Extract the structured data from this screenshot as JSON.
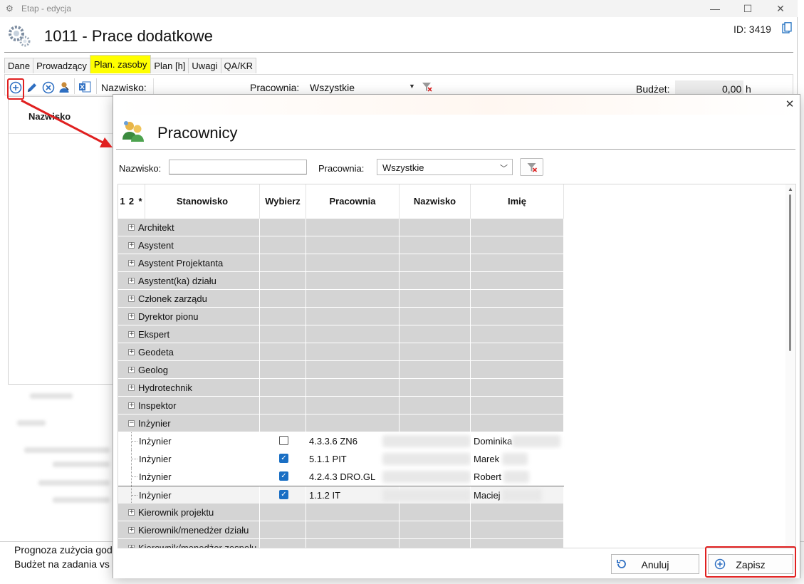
{
  "background_window": {
    "title": "Etap - edycja",
    "controls": {
      "minimize": "—",
      "maximize": "☐",
      "close": "✕"
    },
    "header_title": "1011 - Prace dodatkowe",
    "id_text": "ID: 3419",
    "tabs": [
      {
        "label": "Dane"
      },
      {
        "label": "Prowadzący"
      },
      {
        "label": "Plan. zasoby",
        "active": true
      },
      {
        "label": "Plan [h]"
      },
      {
        "label": "Uwagi"
      },
      {
        "label": "QA/KR"
      }
    ],
    "toolbar": {
      "nazwisko_label": "Nazwisko:",
      "pracownia_label": "Pracownia:",
      "pracownia_value": "Wszystkie",
      "budzet_label": "Budżet:",
      "budzet_value": "0,00",
      "budzet_unit": "h",
      "icons": [
        "add-icon",
        "edit-icon",
        "delete-icon",
        "user-icon",
        "excel-icon"
      ]
    },
    "grid": {
      "column_nazwisko": "Nazwisko"
    },
    "bottom_lines": [
      "Prognoza zużycia god",
      "Budżet na zadania vs"
    ]
  },
  "dialog": {
    "title": "Pracownicy",
    "close": "✕",
    "filter": {
      "nazwisko_label": "Nazwisko:",
      "nazwisko_value": "",
      "pracownia_label": "Pracownia:",
      "pracownia_value": "Wszystkie"
    },
    "grid": {
      "headers": {
        "c1": "1",
        "c2": "2",
        "c3": "*",
        "stanowisko": "Stanowisko",
        "wybierz": "Wybierz",
        "pracownia": "Pracownia",
        "nazwisko": "Nazwisko",
        "imie": "Imię"
      },
      "groups_before": [
        "Architekt",
        "Asystent",
        "Asystent Projektanta",
        "Asystent(ka) działu",
        "Członek zarządu",
        "Dyrektor pionu",
        "Ekspert",
        "Geodeta",
        "Geolog",
        "Hydrotechnik",
        "Inspektor"
      ],
      "expanded_group": "Inżynier",
      "expanded_rows": [
        {
          "stanowisko": "Inżynier",
          "selected": false,
          "pracownia": "4.3.3.6 ZN6",
          "imie": "Dominika"
        },
        {
          "stanowisko": "Inżynier",
          "selected": true,
          "pracownia": "5.1.1 PIT",
          "imie": "Marek"
        },
        {
          "stanowisko": "Inżynier",
          "selected": true,
          "pracownia": "4.2.4.3 DRO.GL",
          "imie": "Robert"
        },
        {
          "stanowisko": "Inżynier",
          "selected": true,
          "pracownia": "1.1.2 IT",
          "imie": "Maciej"
        }
      ],
      "groups_after": [
        "Kierownik projektu",
        "Kierownik/menedżer działu",
        "Kierownik/menedżer zespołu"
      ]
    },
    "buttons": {
      "cancel": "Anuluj",
      "save": "Zapisz"
    }
  },
  "colors": {
    "active_tab": "#ffff00",
    "annotation": "#e02020",
    "checkbox": "#1a6fc4",
    "group_row": "#d4d4d4"
  }
}
